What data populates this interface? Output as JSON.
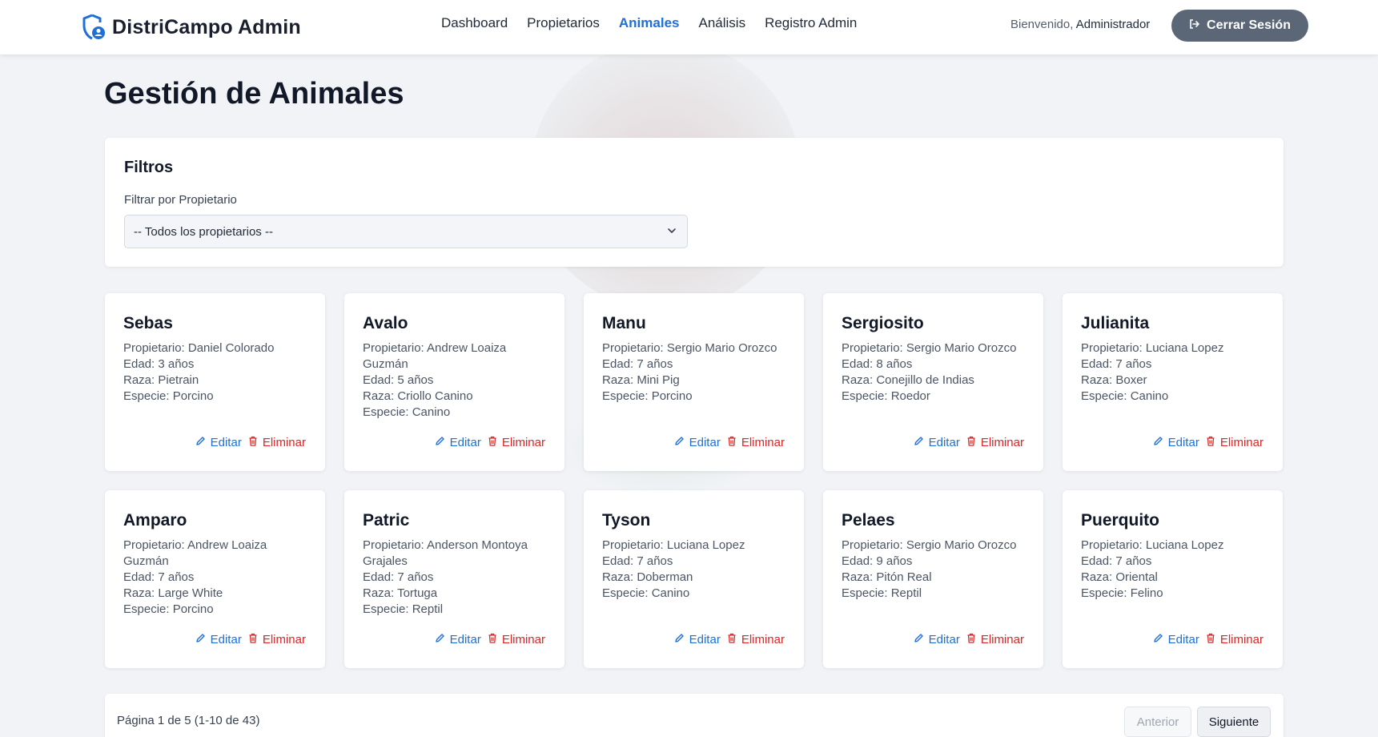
{
  "header": {
    "brand": "DistriCampo Admin",
    "nav": [
      {
        "label": "Dashboard"
      },
      {
        "label": "Propietarios"
      },
      {
        "label": "Animales"
      },
      {
        "label": "Análisis"
      },
      {
        "label": "Registro Admin"
      }
    ],
    "active_nav": "Animales",
    "welcome_prefix": "Bienvenido,",
    "welcome_user": "Administrador",
    "logout_label": "Cerrar Sesión"
  },
  "page": {
    "title": "Gestión de Animales"
  },
  "filters": {
    "title": "Filtros",
    "owner_label": "Filtrar por Propietario",
    "owner_selected": "-- Todos los propietarios --"
  },
  "actions": {
    "edit": "Editar",
    "delete": "Eliminar"
  },
  "animals": [
    {
      "name": "Sebas",
      "owner": "Propietario: Daniel Colorado",
      "age": "Edad: 3 años",
      "breed": "Raza: Pietrain",
      "species": "Especie: Porcino"
    },
    {
      "name": "Avalo",
      "owner": "Propietario: Andrew Loaiza Guzmán",
      "age": "Edad: 5 años",
      "breed": "Raza: Criollo Canino",
      "species": "Especie: Canino"
    },
    {
      "name": "Manu",
      "owner": "Propietario: Sergio Mario Orozco",
      "age": "Edad: 7 años",
      "breed": "Raza: Mini Pig",
      "species": "Especie: Porcino"
    },
    {
      "name": "Sergiosito",
      "owner": "Propietario: Sergio Mario Orozco",
      "age": "Edad: 8 años",
      "breed": "Raza: Conejillo de Indias",
      "species": "Especie: Roedor"
    },
    {
      "name": "Julianita",
      "owner": "Propietario: Luciana Lopez",
      "age": "Edad: 7 años",
      "breed": "Raza: Boxer",
      "species": "Especie: Canino"
    },
    {
      "name": "Amparo",
      "owner": "Propietario: Andrew Loaiza Guzmán",
      "age": "Edad: 7 años",
      "breed": "Raza: Large White",
      "species": "Especie: Porcino"
    },
    {
      "name": "Patric",
      "owner": "Propietario: Anderson Montoya Grajales",
      "age": "Edad: 7 años",
      "breed": "Raza: Tortuga",
      "species": "Especie: Reptil"
    },
    {
      "name": "Tyson",
      "owner": "Propietario: Luciana Lopez",
      "age": "Edad: 7 años",
      "breed": "Raza: Doberman",
      "species": "Especie: Canino"
    },
    {
      "name": "Pelaes",
      "owner": "Propietario: Sergio Mario Orozco",
      "age": "Edad: 9 años",
      "breed": "Raza: Pitón Real",
      "species": "Especie: Reptil"
    },
    {
      "name": "Puerquito",
      "owner": "Propietario: Luciana Lopez",
      "age": "Edad: 7 años",
      "breed": "Raza: Oriental",
      "species": "Especie: Felino"
    }
  ],
  "pagination": {
    "info": "Página 1 de 5 (1-10 de 43)",
    "prev_label": "Anterior",
    "next_label": "Siguiente"
  },
  "colors": {
    "accent": "#1f6fd6",
    "danger": "#dc2626",
    "logout_bg": "#5b6676",
    "page_bg": "#f1f3f6"
  }
}
